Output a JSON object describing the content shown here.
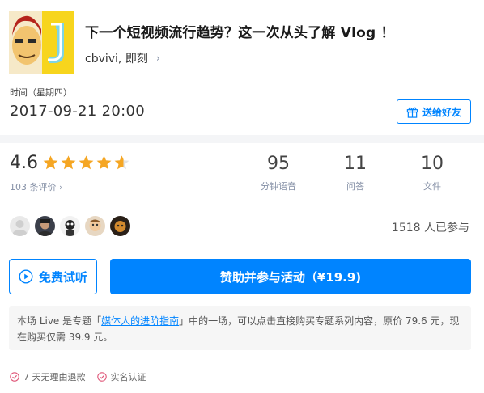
{
  "header": {
    "title": "下一个短视频流行趋势？这一次从头了解 Vlog ！",
    "author": "cbvivi, 即刻",
    "author_chevron": "›"
  },
  "time": {
    "label": "时间（星期四）",
    "value": "2017-09-21 20:00"
  },
  "gift_button": {
    "label": "送给好友",
    "icon": "gift-icon"
  },
  "rating": {
    "score": "4.6",
    "stars_value": 4.6,
    "stars_max": 5,
    "review_count": "103 条评价 ›"
  },
  "stats": [
    {
      "value": "95",
      "label": "分钟语音"
    },
    {
      "value": "11",
      "label": "问答"
    },
    {
      "value": "10",
      "label": "文件"
    }
  ],
  "participants": {
    "joined_text": "1518 人已参与",
    "avatar_count": 5
  },
  "actions": {
    "listen_label": "免费试听",
    "listen_icon": "play-circle-icon",
    "buy_label": "赞助并参与活动（¥19.9)"
  },
  "notice": {
    "text_before": "本场 Live 是专题「",
    "link_text": "媒体人的进阶指南",
    "text_after": "」中的一场，可以点击直接购买专题系列内容，原价 79.6 元，现在购买仅需 39.9 元。"
  },
  "footer": {
    "items": [
      {
        "label": "7 天无理由退款",
        "icon": "check-circle-icon"
      },
      {
        "label": "实名认证",
        "icon": "check-circle-icon"
      }
    ]
  },
  "colors": {
    "accent": "#0084ff",
    "star": "#f5a623",
    "muted": "#8590a6"
  }
}
